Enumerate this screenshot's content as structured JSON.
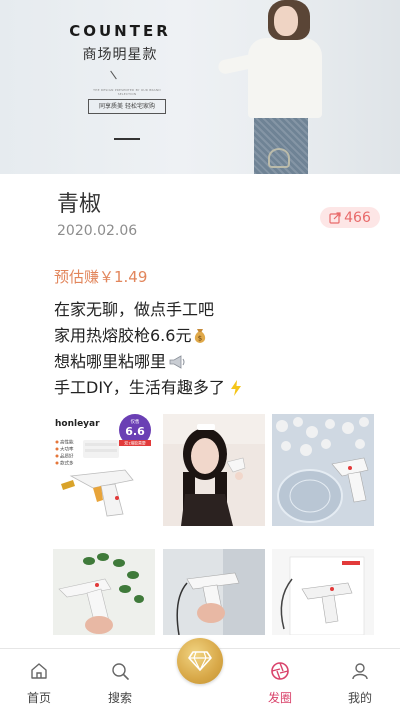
{
  "banner": {
    "brand": "COUNTER",
    "subtitle": "商场明星款",
    "tag": "同享质美 轻松宅家购",
    "small_print": "THE DESIGN PRESENTED BY OUR BRAND SELECTION"
  },
  "post": {
    "author": "青椒",
    "date": "2020.02.06",
    "share_count": "466",
    "estimated_earn": "预估赚￥1.49",
    "lines": [
      "在家无聊，做点手工吧",
      "家用热熔胶枪6.6元",
      "想粘哪里粘哪里",
      "手工DIY，生活有趣多了"
    ],
    "photo1": {
      "brand": "honleyar",
      "price": "6.6",
      "price_note": "仅售",
      "ribbon": "双1熔胶需要",
      "features": [
        "高性能",
        "大功率",
        "品质好",
        "款式多"
      ]
    }
  },
  "nav": {
    "items": [
      {
        "label": "首页"
      },
      {
        "label": "搜索"
      },
      {
        "label": "发圈"
      },
      {
        "label": "我的"
      }
    ],
    "active_color": "#d9436b"
  },
  "colors": {
    "earn": "#e2865c",
    "share_bg": "#fde6e6",
    "share_text": "#e86a6a",
    "center_button": "#d8a848"
  }
}
